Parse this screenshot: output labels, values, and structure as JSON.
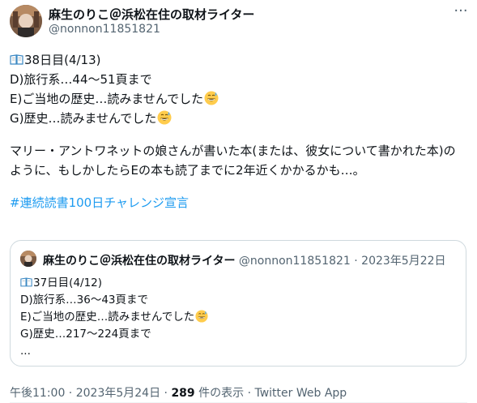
{
  "author": {
    "name": "麻生のりこ＠浜松在住の取材ライター",
    "handle": "@nonnon11851821"
  },
  "tweet": {
    "line1": "38日目(4/13)",
    "line2": "D)旅行系…44～51頁まで",
    "line3": "E)ご当地の歴史…読みませんでした",
    "line4": "G)歴史…読みませんでした",
    "paragraph": "マリー・アントワネットの娘さんが書いた本(または、彼女について書かれた本)のように、もしかしたらEの本も読了までに2年近くかかるかも…。",
    "hashtag": "#連続読書100日チャレンジ宣言"
  },
  "quote": {
    "name": "麻生のりこ＠浜松在住の取材ライター",
    "handle": "@nonnon11851821",
    "separator": " · ",
    "date": "2023年5月22日",
    "line1": "37日目(4/12)",
    "line2": "D)旅行系…36～43頁まで",
    "line3": "E)ご当地の歴史…読みませんでした",
    "line4": "G)歴史…217～224頁まで",
    "line5": "..."
  },
  "footer": {
    "time": "午後11:00",
    "sep1": " · ",
    "date": "2023年5月24日",
    "sep2": " · ",
    "views_count": "289",
    "views_label": " 件の表示",
    "sep3": " · ",
    "source": "Twitter Web App"
  },
  "icons": {
    "more": "more-icon",
    "book": "open-book-icon",
    "emoji": "grinning-sweat-emoji"
  },
  "colors": {
    "link": "#1d9bf0",
    "secondary_text": "#536471",
    "border": "#cfd9de"
  }
}
